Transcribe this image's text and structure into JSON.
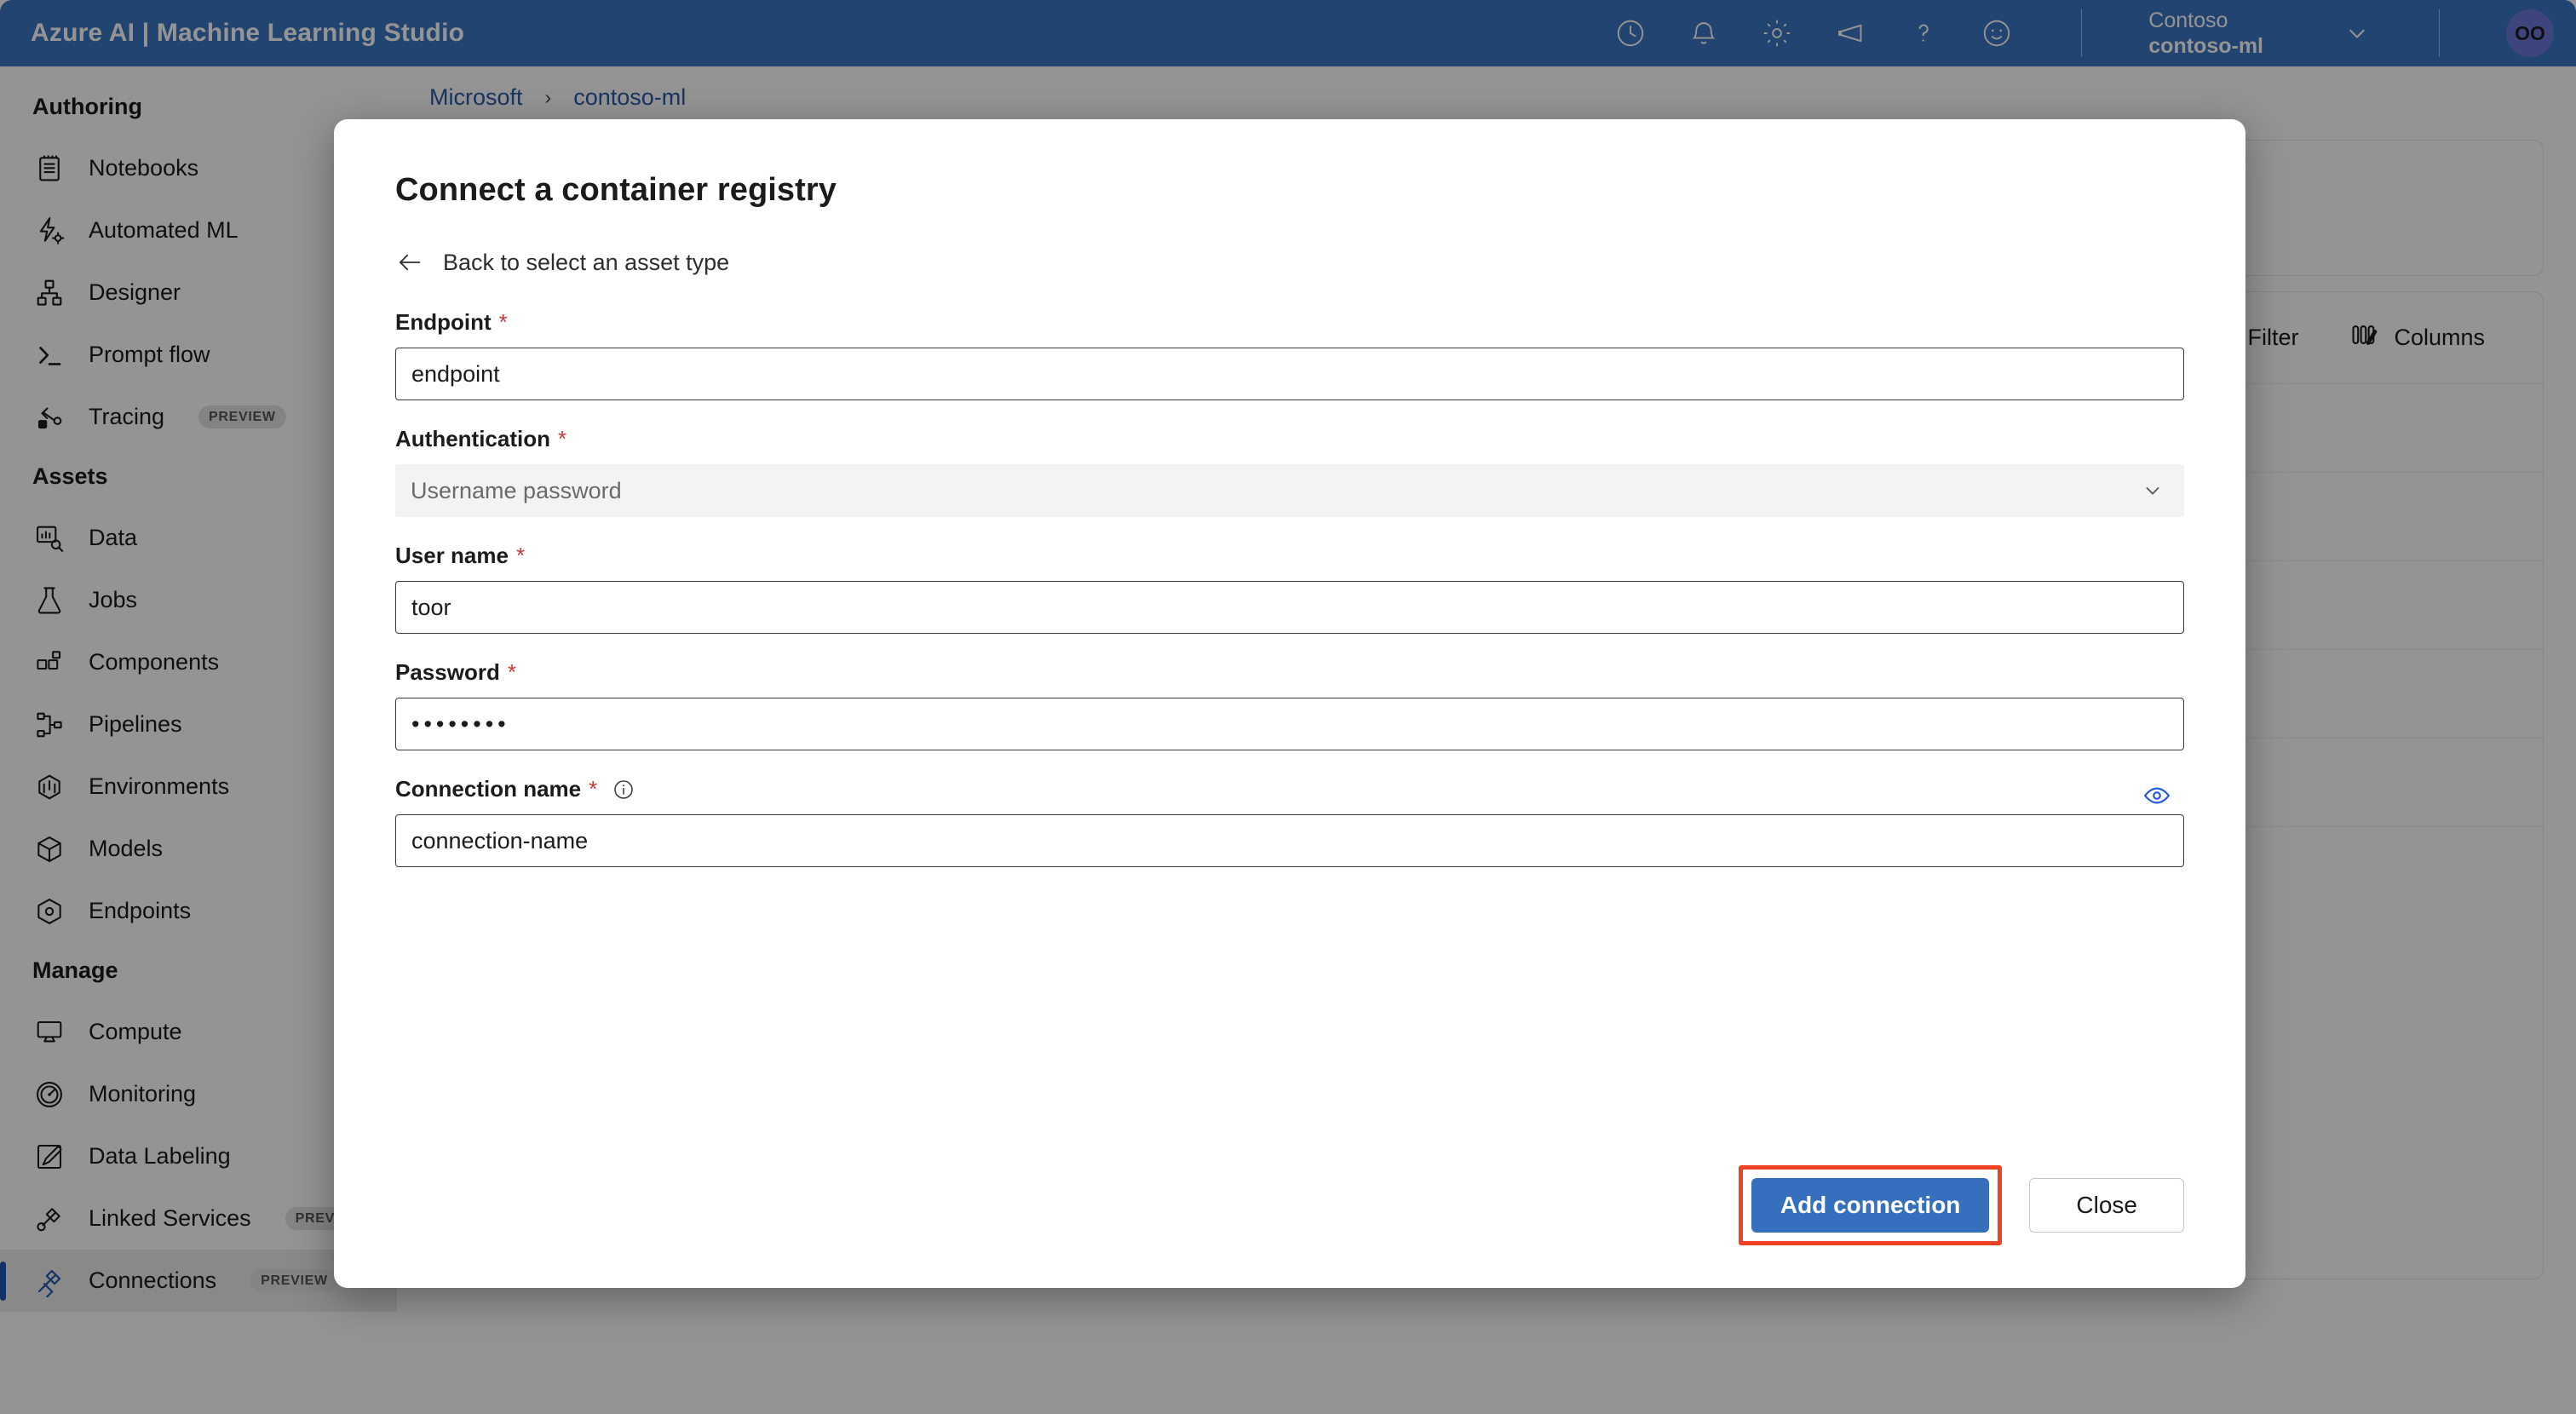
{
  "header": {
    "title": "Azure AI | Machine Learning Studio",
    "icons": [
      "recent-icon",
      "bell-icon",
      "gear-icon",
      "megaphone-icon",
      "help-icon",
      "feedback-icon"
    ],
    "tenant_name": "Contoso",
    "workspace_name": "contoso-ml",
    "avatar_initials": "OO",
    "brand_color": "#3b75c3"
  },
  "sidebar": {
    "groups": [
      {
        "title": "Authoring",
        "items": [
          {
            "label": "Notebooks",
            "icon": "notebook-icon",
            "badge": "",
            "selected": false
          },
          {
            "label": "Automated ML",
            "icon": "automated-ml-icon",
            "badge": "",
            "selected": false
          },
          {
            "label": "Designer",
            "icon": "designer-icon",
            "badge": "",
            "selected": false
          },
          {
            "label": "Prompt flow",
            "icon": "prompt-flow-icon",
            "badge": "",
            "selected": false
          },
          {
            "label": "Tracing",
            "icon": "tracing-icon",
            "badge": "PREVIEW",
            "selected": false
          }
        ]
      },
      {
        "title": "Assets",
        "items": [
          {
            "label": "Data",
            "icon": "data-icon",
            "badge": "",
            "selected": false
          },
          {
            "label": "Jobs",
            "icon": "jobs-icon",
            "badge": "",
            "selected": false
          },
          {
            "label": "Components",
            "icon": "components-icon",
            "badge": "",
            "selected": false
          },
          {
            "label": "Pipelines",
            "icon": "pipelines-icon",
            "badge": "",
            "selected": false
          },
          {
            "label": "Environments",
            "icon": "environments-icon",
            "badge": "",
            "selected": false
          },
          {
            "label": "Models",
            "icon": "models-icon",
            "badge": "",
            "selected": false
          },
          {
            "label": "Endpoints",
            "icon": "endpoints-icon",
            "badge": "",
            "selected": false
          }
        ]
      },
      {
        "title": "Manage",
        "items": [
          {
            "label": "Compute",
            "icon": "compute-icon",
            "badge": "",
            "selected": false
          },
          {
            "label": "Monitoring",
            "icon": "monitoring-icon",
            "badge": "",
            "selected": false
          },
          {
            "label": "Data Labeling",
            "icon": "data-labeling-icon",
            "badge": "",
            "selected": false
          },
          {
            "label": "Linked Services",
            "icon": "linked-services-icon",
            "badge": "PREVIEW",
            "selected": false
          },
          {
            "label": "Connections",
            "icon": "connections-icon",
            "badge": "PREVIEW",
            "selected": true
          }
        ]
      }
    ],
    "selected_accent": "#1f56b0"
  },
  "breadcrumb": {
    "items": [
      "Microsoft",
      "contoso-ml"
    ],
    "separator": "›",
    "link_color": "#2a5ca8"
  },
  "toolbar": {
    "filter_label": "Filter",
    "columns_label": "Columns"
  },
  "modal": {
    "title": "Connect a container registry",
    "back_label": "Back to select an asset type",
    "required_marker": "*",
    "fields": {
      "endpoint": {
        "label": "Endpoint",
        "value": "endpoint"
      },
      "authentication": {
        "label": "Authentication",
        "value": "Username password"
      },
      "username": {
        "label": "User name",
        "value": "toor"
      },
      "password": {
        "label": "Password",
        "value": "••••••••"
      },
      "connection_name": {
        "label": "Connection name",
        "value": "connection-name"
      }
    },
    "buttons": {
      "primary": "Add connection",
      "secondary": "Close"
    },
    "highlight_color": "#ef4123",
    "primary_color": "#3670bd"
  }
}
